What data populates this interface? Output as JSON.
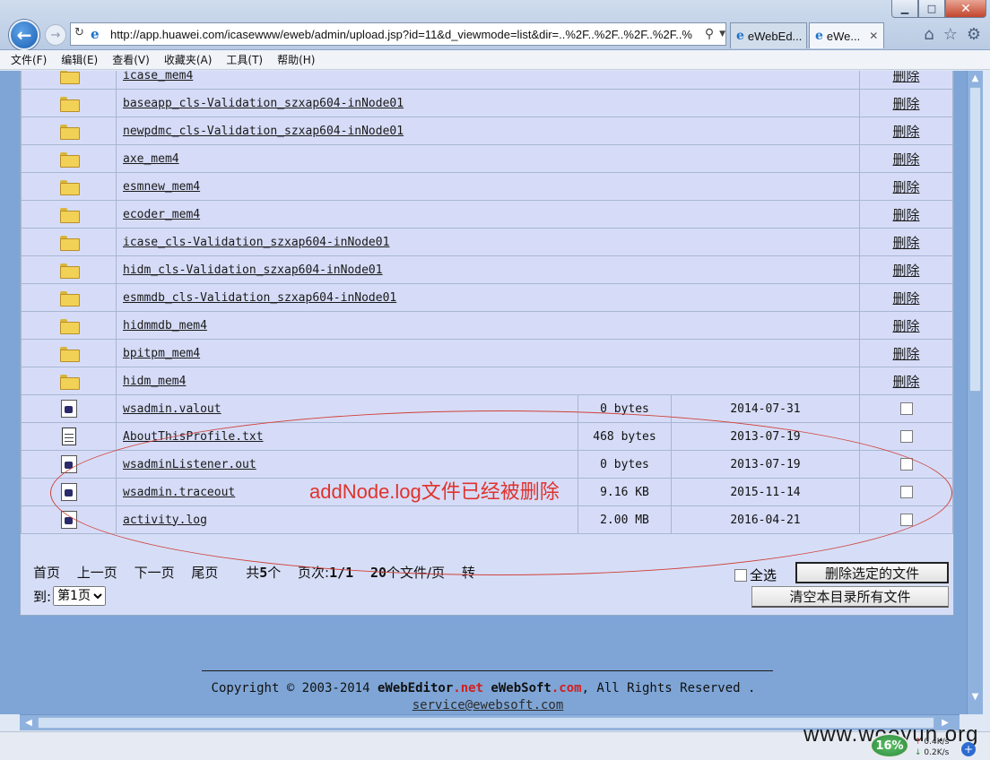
{
  "browser": {
    "url": "http://app.huawei.com/icasewww/eweb/admin/upload.jsp?id=11&d_viewmode=list&dir=..%2F..%2F..%2F..%2F..%",
    "tabs": [
      {
        "label": "eWebEd...",
        "active": false
      },
      {
        "label": "eWe...",
        "active": true
      }
    ],
    "window_buttons": {
      "minimize": "▁",
      "maximize": "□",
      "close": "✕"
    },
    "menu": [
      "文件(F)",
      "编辑(E)",
      "查看(V)",
      "收藏夹(A)",
      "工具(T)",
      "帮助(H)"
    ]
  },
  "folders": [
    {
      "name": "icase_mem4",
      "action": "删除"
    },
    {
      "name": "baseapp_cls-Validation_szxap604-inNode01",
      "action": "删除"
    },
    {
      "name": "newpdmc_cls-Validation_szxap604-inNode01",
      "action": "删除"
    },
    {
      "name": "axe_mem4",
      "action": "删除"
    },
    {
      "name": "esmnew_mem4",
      "action": "删除"
    },
    {
      "name": "ecoder_mem4",
      "action": "删除"
    },
    {
      "name": "icase_cls-Validation_szxap604-inNode01",
      "action": "删除"
    },
    {
      "name": "hidm_cls-Validation_szxap604-inNode01",
      "action": "删除"
    },
    {
      "name": "esmmdb_cls-Validation_szxap604-inNode01",
      "action": "删除"
    },
    {
      "name": "hidmmdb_mem4",
      "action": "删除"
    },
    {
      "name": "bpitpm_mem4",
      "action": "删除"
    },
    {
      "name": "hidm_mem4",
      "action": "删除"
    }
  ],
  "files": [
    {
      "name": "wsadmin.valout",
      "size": "0 bytes",
      "date": "2014-07-31",
      "icon": "generic-file-icon"
    },
    {
      "name": "AboutThisProfile.txt",
      "size": "468 bytes",
      "date": "2013-07-19",
      "icon": "text-file-icon"
    },
    {
      "name": "wsadminListener.out",
      "size": "0 bytes",
      "date": "2013-07-19",
      "icon": "generic-file-icon"
    },
    {
      "name": "wsadmin.traceout",
      "size": "9.16 KB",
      "date": "2015-11-14",
      "icon": "generic-file-icon"
    },
    {
      "name": "activity.log",
      "size": "2.00 MB",
      "date": "2016-04-21",
      "icon": "generic-file-icon"
    }
  ],
  "pager": {
    "first": "首页",
    "prev": "上一页",
    "next": "下一页",
    "last": "尾页",
    "total_prefix": "共",
    "total_count": "5",
    "total_unit": "个",
    "page_prefix": "页次:",
    "page_value": "1/1",
    "per_page_count": "20",
    "per_page_unit": "个文件/页",
    "goto_label": "转",
    "to_label": "到:",
    "page_select": "第1页"
  },
  "actions": {
    "select_all": "全选",
    "delete_selected": "删除选定的文件",
    "clear_all": "清空本目录所有文件"
  },
  "annotation": {
    "text": "addNode.log文件已经被删除",
    "color": "#e0322c"
  },
  "footer": {
    "copyright_prefix": "Copyright © 2003-2014 ",
    "brand1_main": "eWebEditor",
    "brand1_suffix": ".net",
    "brand2_main": "eWebSoft",
    "brand2_suffix": ".com",
    "copyright_suffix": ", All Rights Reserved .",
    "email": "service@ewebsoft.com"
  },
  "status": {
    "watermark": "www.wooyun.org",
    "net_percent": "16%",
    "upload_speed": "0.4K/s",
    "download_speed": "0.2K/s"
  }
}
